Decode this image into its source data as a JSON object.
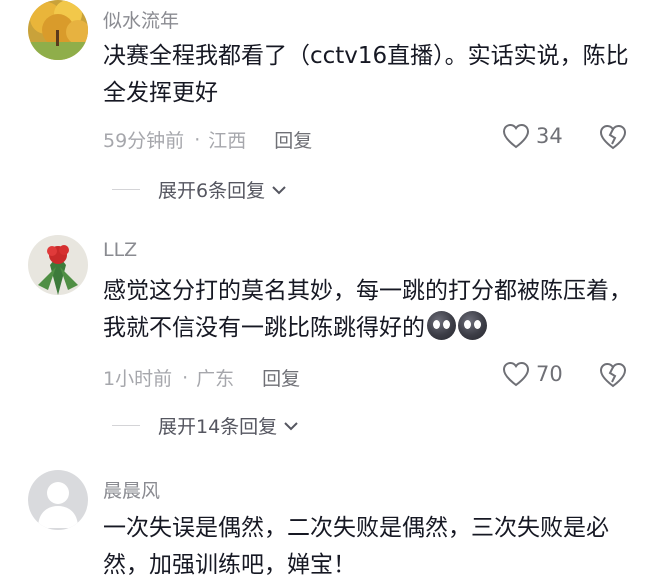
{
  "comments": [
    {
      "username": "似水流年",
      "text": "决赛全程我都看了（cctv16直播）。实话实说，陈比全发挥更好",
      "time": "59分钟前",
      "location": "江西",
      "reply_label": "回复",
      "likes": "34",
      "expand_label": "展开6条回复",
      "avatar_icon": "autumn-tree-avatar"
    },
    {
      "username": "LLZ",
      "text": "感觉这分打的莫名其妙，每一跳的打分都被陈压着，我就不信没有一跳比陈跳得好的",
      "emoji_count": 2,
      "time": "1小时前",
      "location": "广东",
      "reply_label": "回复",
      "likes": "70",
      "expand_label": "展开14条回复",
      "avatar_icon": "flower-avatar"
    },
    {
      "username": "晨晨风",
      "text": "一次失误是偶然，二次失败是偶然，三次失败是必然，加强训练吧，婵宝！",
      "avatar_icon": "default-person-avatar"
    }
  ],
  "colors": {
    "text_primary": "#161823",
    "text_secondary": "#8a8b91",
    "meta": "#a6a7ac"
  }
}
